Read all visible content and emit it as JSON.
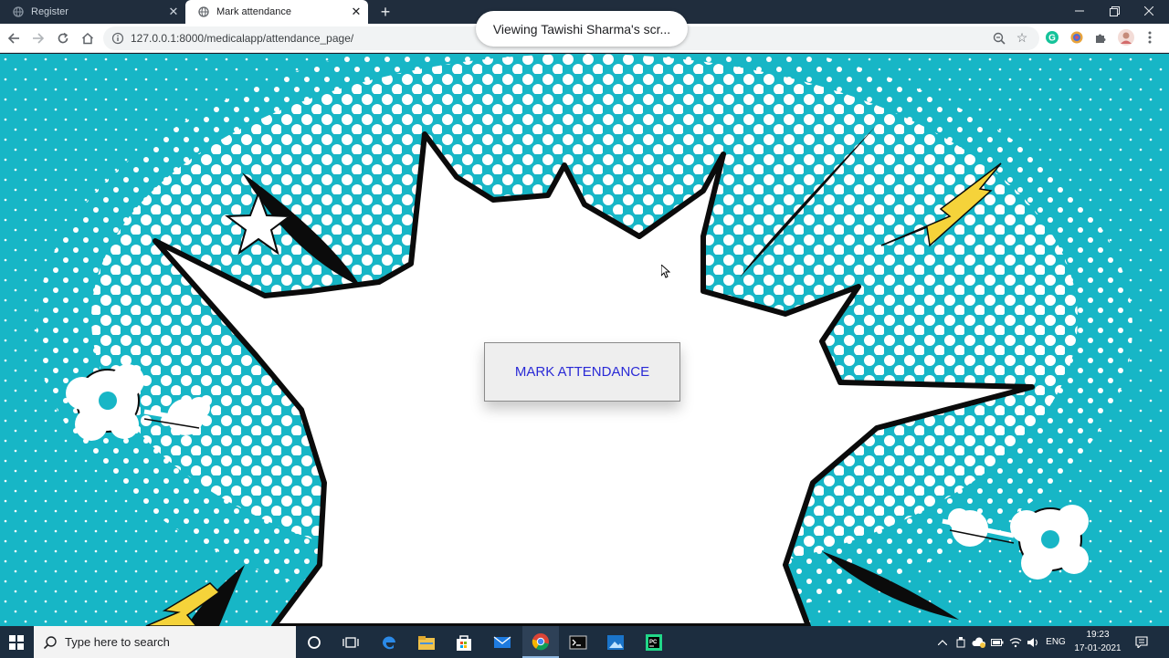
{
  "browser": {
    "tabs": [
      {
        "title": "Register",
        "favicon": "globe-icon",
        "active": false
      },
      {
        "title": "Mark attendance",
        "favicon": "globe-icon",
        "active": true
      }
    ],
    "url": "127.0.0.1:8000/medicalapp/attendance_page/",
    "share_notice": "Viewing Tawishi Sharma's scr...",
    "extensions": [
      "grammarly-icon",
      "extension-color-icon",
      "puzzle-icon",
      "profile-avatar-icon",
      "more-menu-icon"
    ]
  },
  "page": {
    "mark_button_label": "MARK ATTENDANCE",
    "background_color": "#17b6c6",
    "button_text_color": "#2a2ad6"
  },
  "taskbar": {
    "search_placeholder": "Type here to search",
    "apps": [
      "cortana-icon",
      "task-view-icon",
      "edge-icon",
      "file-explorer-icon",
      "store-icon",
      "mail-icon",
      "chrome-icon",
      "terminal-icon",
      "photos-icon",
      "pycharm-icon"
    ],
    "active_app": "chrome-icon",
    "language": "ENG",
    "time": "19:23",
    "date": "17-01-2021"
  }
}
